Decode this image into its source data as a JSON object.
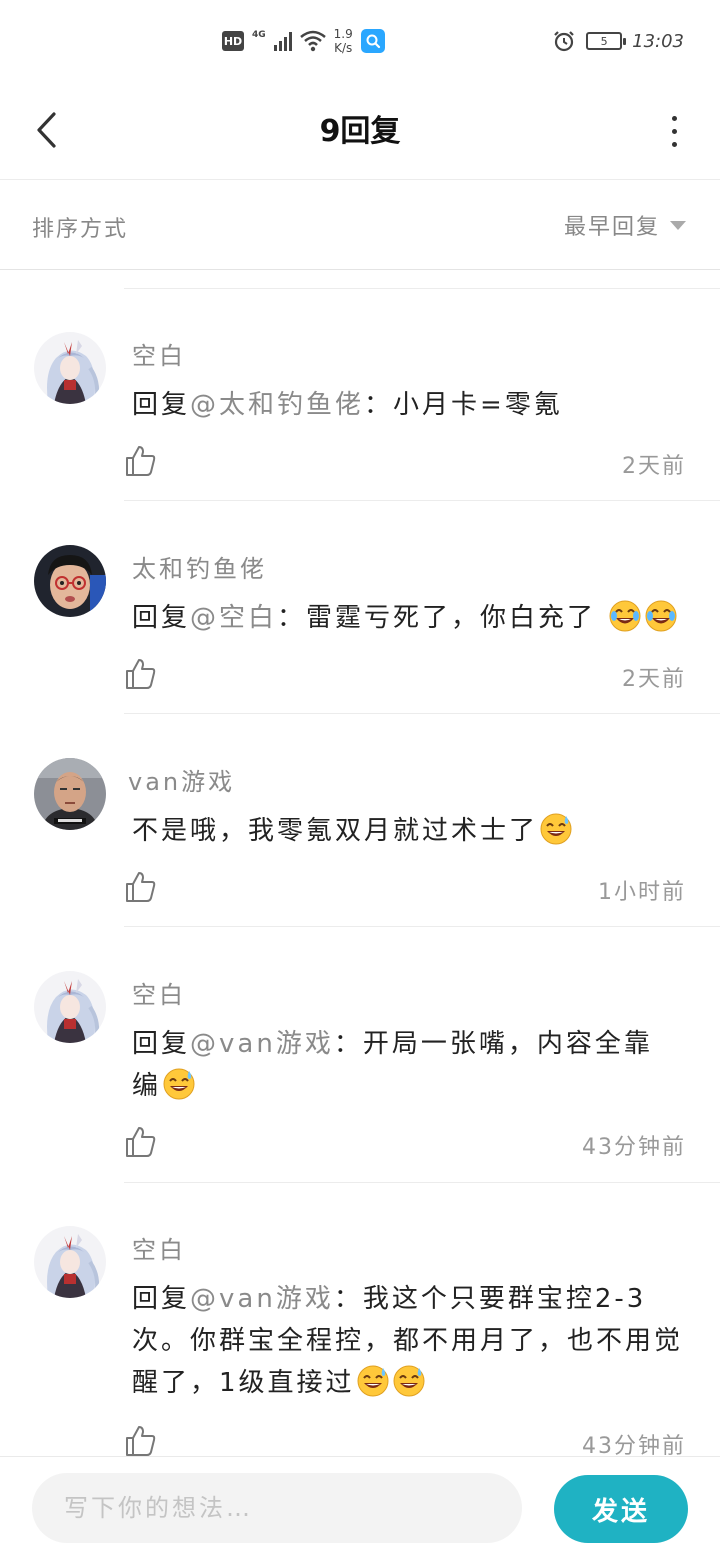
{
  "status_bar": {
    "hd": "HD",
    "network": "4G",
    "speed_value": "1.9",
    "speed_unit": "K/s",
    "battery_level": "5",
    "time": "13:03"
  },
  "nav": {
    "title": "9回复"
  },
  "sort": {
    "label": "排序方式",
    "selected": "最早回复"
  },
  "comments": [
    {
      "author": "空白",
      "prefix": "回复",
      "mention": "@太和钓鱼佬",
      "text": "：小月卡=零氪",
      "emoji_names": [],
      "time": "2天前",
      "avatar": "anime-girl"
    },
    {
      "author": "太和钓鱼佬",
      "prefix": "回复",
      "mention": "@空白",
      "text": "：雷霆亏死了，你白充了 ",
      "emoji_names": [
        "laughing-tears-emoji",
        "laughing-tears-emoji"
      ],
      "time": "2天前",
      "avatar": "man-glasses"
    },
    {
      "author": "van游戏",
      "prefix": "",
      "mention": "",
      "text": "不是哦，我零氪双月就过术士了",
      "emoji_names": [
        "sweat-smile-emoji"
      ],
      "time": "1小时前",
      "avatar": "man-bald"
    },
    {
      "author": "空白",
      "prefix": "回复",
      "mention": "@van游戏",
      "text": "：开局一张嘴，内容全靠编",
      "emoji_names": [
        "sweat-smile-emoji"
      ],
      "time": "43分钟前",
      "avatar": "anime-girl"
    },
    {
      "author": "空白",
      "prefix": "回复",
      "mention": "@van游戏",
      "text": "：我这个只要群宝控2-3次。你群宝全程控，都不用月了，也不用觉醒了，1级直接过",
      "emoji_names": [
        "sweat-smile-emoji",
        "sweat-smile-emoji"
      ],
      "time": "43分钟前",
      "avatar": "anime-girl"
    }
  ],
  "reply": {
    "placeholder": "写下你的想法…",
    "value": "",
    "send_label": "发送"
  },
  "colors": {
    "accent": "#1fb2c3",
    "muted_text": "#8a8a8a",
    "divider": "#ececec"
  }
}
